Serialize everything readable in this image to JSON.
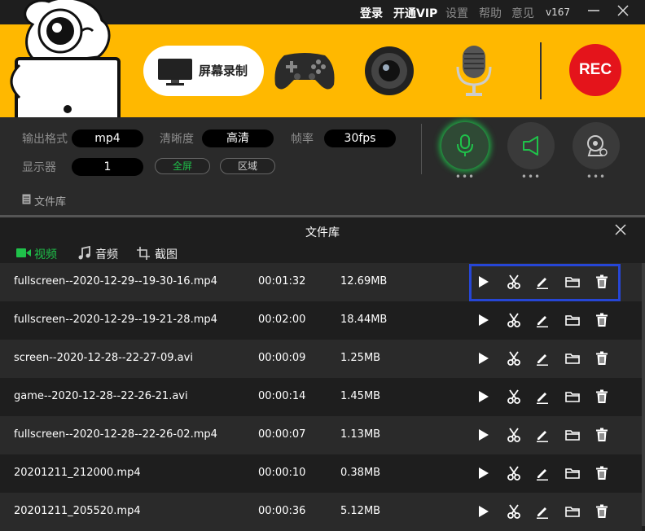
{
  "titlebar": {
    "login": "登录",
    "vip": "开通VIP",
    "settings": "设置",
    "help": "帮助",
    "feedback": "意见",
    "version": "v167"
  },
  "header": {
    "modes": [
      {
        "id": "screen",
        "label": "屏幕录制",
        "icon": "monitor-icon",
        "active": true
      },
      {
        "id": "game",
        "label": "",
        "icon": "gamepad-icon"
      },
      {
        "id": "camera",
        "label": "",
        "icon": "camera-icon"
      },
      {
        "id": "audio",
        "label": "",
        "icon": "microphone-icon"
      }
    ],
    "rec_label": "REC",
    "accent": "#ffb800",
    "rec_color": "#e4141b"
  },
  "settings": {
    "format_label": "输出格式",
    "format_value": "mp4",
    "quality_label": "清晰度",
    "quality_value": "高清",
    "fps_label": "帧率",
    "fps_value": "30fps",
    "display_label": "显示器",
    "display_value": "1",
    "fullscreen_label": "全屏",
    "region_label": "区域",
    "mic_icon": "microphone-icon",
    "speaker_icon": "speaker-icon",
    "webcam_icon": "webcam-icon",
    "more": "•••",
    "active_color": "#1fc24a"
  },
  "library_bar": {
    "label": "文件库"
  },
  "dialog": {
    "title": "文件库",
    "tabs": [
      {
        "label": "视频",
        "icon": "video-icon",
        "active": true
      },
      {
        "label": "音频",
        "icon": "music-icon"
      },
      {
        "label": "截图",
        "icon": "screenshot-icon"
      }
    ],
    "files": [
      {
        "name": "fullscreen--2020-12-29--19-30-16.mp4",
        "duration": "00:01:32",
        "size": "12.69MB"
      },
      {
        "name": "fullscreen--2020-12-29--19-21-28.mp4",
        "duration": "00:02:00",
        "size": "18.44MB"
      },
      {
        "name": "screen--2020-12-28--22-27-09.avi",
        "duration": "00:00:09",
        "size": "1.25MB"
      },
      {
        "name": "game--2020-12-28--22-26-21.avi",
        "duration": "00:00:14",
        "size": "1.45MB"
      },
      {
        "name": "fullscreen--2020-12-28--22-26-02.mp4",
        "duration": "00:00:07",
        "size": "1.13MB"
      },
      {
        "name": "20201211_212000.mp4",
        "duration": "00:00:10",
        "size": "0.38MB"
      },
      {
        "name": "20201211_205520.mp4",
        "duration": "00:00:36",
        "size": "5.12MB"
      }
    ],
    "actions": [
      "play-icon",
      "scissors-icon",
      "edit-icon",
      "folder-icon",
      "trash-icon"
    ],
    "highlight_color": "#2646d6"
  }
}
